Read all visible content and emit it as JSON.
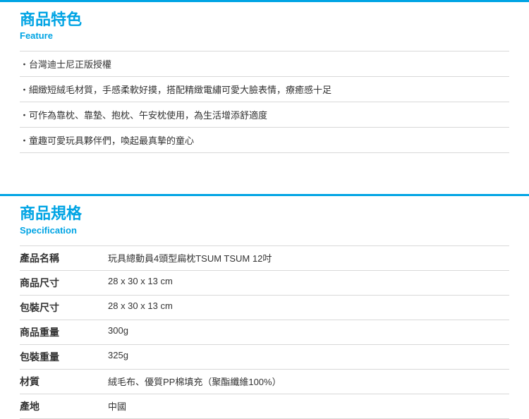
{
  "feature": {
    "title": "商品特色",
    "sub": "Feature",
    "items": [
      "・台灣迪士尼正版授權",
      "・細緻短絨毛材質，手感柔軟好摸，搭配精緻電繡可愛大臉表情，療癒感十足",
      "・可作為靠枕、靠墊、抱枕、午安枕使用，為生活增添舒適度",
      "・童趣可愛玩具夥伴們，喚起最真摯的童心"
    ]
  },
  "spec": {
    "title": "商品規格",
    "sub": "Specification",
    "rows": [
      {
        "label": "產品名稱",
        "value": "玩具總動員4頭型扁枕TSUM TSUM 12吋"
      },
      {
        "label": "商品尺寸",
        "value": "28 x 30 x 13 cm"
      },
      {
        "label": "包裝尺寸",
        "value": "28 x 30 x 13 cm"
      },
      {
        "label": "商品重量",
        "value": "300g"
      },
      {
        "label": "包裝重量",
        "value": "325g"
      },
      {
        "label": "材質",
        "value": "絨毛布、優質PP棉填充（聚酯纖維100%）"
      },
      {
        "label": "產地",
        "value": "中國"
      }
    ]
  }
}
